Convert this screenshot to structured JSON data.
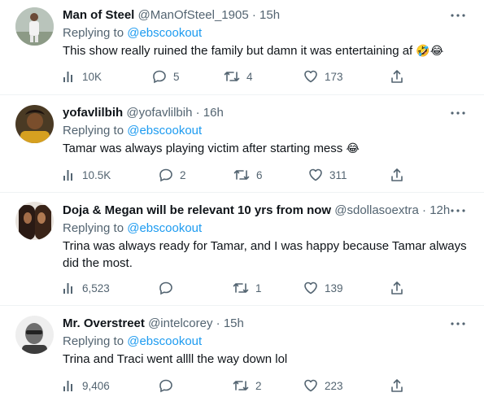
{
  "tweets": [
    {
      "name": "Man of Steel",
      "handle": "@ManOfSteel_1905",
      "time": "15h",
      "replying_prefix": "Replying to ",
      "replying_to": "@ebscookout",
      "text": "This show really ruined the family but damn it was entertaining af",
      "emoji": "🤣😂",
      "views": "10K",
      "replies": "5",
      "retweets": "4",
      "likes": "173"
    },
    {
      "name": "yofavlilbih",
      "handle": "@yofavlilbih",
      "time": "16h",
      "replying_prefix": "Replying to ",
      "replying_to": "@ebscookout",
      "text": "Tamar was always playing victim after starting mess",
      "emoji": "😂",
      "views": "10.5K",
      "replies": "2",
      "retweets": "6",
      "likes": "311"
    },
    {
      "name": "Doja & Megan will be relevant 10 yrs from now",
      "handle": "@sdollasoextra",
      "time": "12h",
      "replying_prefix": "Replying to ",
      "replying_to": "@ebscookout",
      "text": "Trina was always ready for Tamar, and I was happy because Tamar always did the most.",
      "emoji": "",
      "views": "6,523",
      "replies": "",
      "retweets": "1",
      "likes": "139"
    },
    {
      "name": "Mr. Overstreet",
      "handle": "@intelcorey",
      "time": "15h",
      "replying_prefix": "Replying to ",
      "replying_to": "@ebscookout",
      "text": "Trina and Traci went allll the way down lol",
      "emoji": "",
      "views": "9,406",
      "replies": "",
      "retweets": "2",
      "likes": "223"
    }
  ],
  "separator": " · ",
  "colors": {
    "link": "#1d9bf0",
    "muted": "#536471",
    "text": "#0f1419",
    "divider": "#eff3f4"
  },
  "icons": {
    "views": "views-icon",
    "reply": "reply-icon",
    "retweet": "retweet-icon",
    "like": "heart-icon",
    "share": "share-icon",
    "more": "more-icon"
  }
}
